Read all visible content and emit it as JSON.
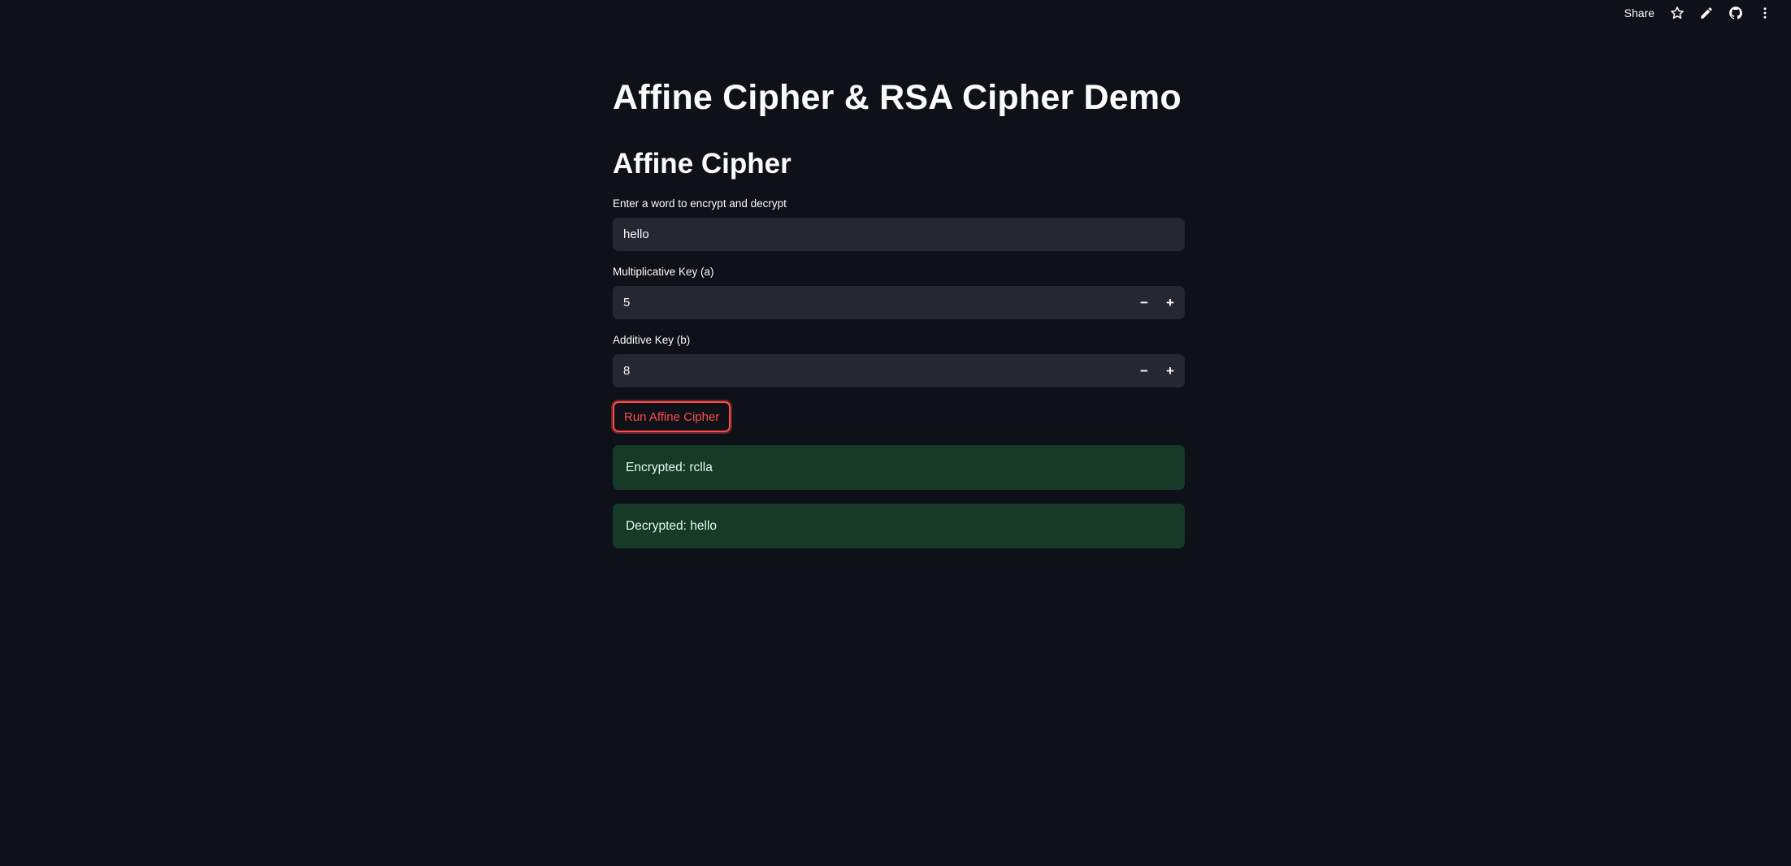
{
  "toolbar": {
    "share_label": "Share",
    "icons": [
      "star-icon",
      "pencil-icon",
      "github-icon",
      "more-vert-icon"
    ]
  },
  "page": {
    "title": "Affine Cipher & RSA Cipher Demo",
    "section_title": "Affine Cipher"
  },
  "form": {
    "word_label": "Enter a word to encrypt and decrypt",
    "word_value": "hello",
    "a_label": "Multiplicative Key (a)",
    "a_value": "5",
    "b_label": "Additive Key (b)",
    "b_value": "8",
    "minus": "−",
    "plus": "+",
    "run_label": "Run Affine Cipher"
  },
  "results": {
    "encrypted": "Encrypted: rclla",
    "decrypted": "Decrypted: hello"
  },
  "colors": {
    "background": "#0e1117",
    "input_bg": "#262730",
    "accent": "#ff4b4b",
    "success_bg": "#173928",
    "success_text": "#dffde9"
  }
}
